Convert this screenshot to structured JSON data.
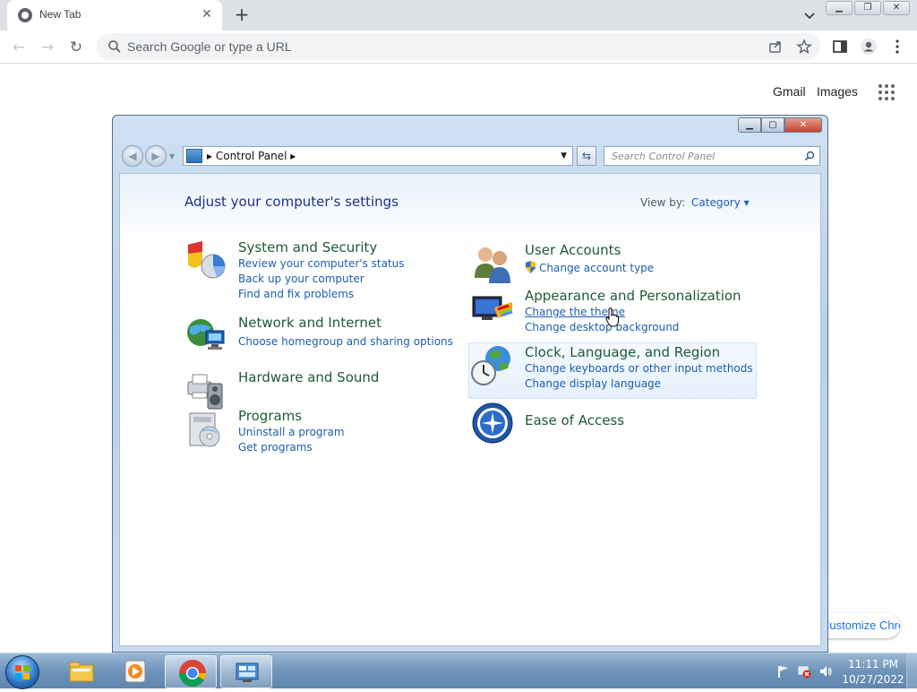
{
  "browser": {
    "tab_title": "New Tab",
    "omnibox_placeholder": "Search Google or type a URL",
    "ntp_links": {
      "gmail": "Gmail",
      "images": "Images"
    },
    "customize_label": "Customize Chrome"
  },
  "control_panel": {
    "breadcrumb": "Control Panel",
    "search_placeholder": "Search Control Panel",
    "heading": "Adjust your computer's settings",
    "view_by_label": "View by:",
    "view_by_value": "Category",
    "categories": [
      {
        "title": "System and Security",
        "links": [
          "Review your computer's status",
          "Back up your computer",
          "Find and fix problems"
        ],
        "icon": "shield-icon"
      },
      {
        "title": "Network and Internet",
        "links": [
          "Choose homegroup and sharing options"
        ],
        "icon": "network-globe-icon"
      },
      {
        "title": "Hardware and Sound",
        "links": [],
        "icon": "printer-speaker-icon"
      },
      {
        "title": "Programs",
        "links": [
          "Uninstall a program",
          "Get programs"
        ],
        "icon": "programs-icon"
      },
      {
        "title": "User Accounts",
        "links": [
          "Change account type"
        ],
        "icon": "users-icon"
      },
      {
        "title": "Appearance and Personalization",
        "links": [
          "Change the theme",
          "Change desktop background"
        ],
        "icon": "monitor-palette-icon"
      },
      {
        "title": "Clock, Language, and Region",
        "links": [
          "Change keyboards or other input methods",
          "Change display language"
        ],
        "icon": "clock-globe-icon"
      },
      {
        "title": "Ease of Access",
        "links": [],
        "icon": "ease-of-access-icon"
      }
    ]
  },
  "taskbar": {
    "time": "11:11 PM",
    "date": "10/27/2022",
    "apps": [
      "file-explorer-icon",
      "media-player-icon",
      "chrome-icon",
      "control-panel-icon"
    ]
  },
  "colors": {
    "chrome_tabstrip": "#dee1e6",
    "cp_title_text": "#1e5a36",
    "cp_link_text": "#1e5dae",
    "taskbar": "#6f93ba"
  }
}
